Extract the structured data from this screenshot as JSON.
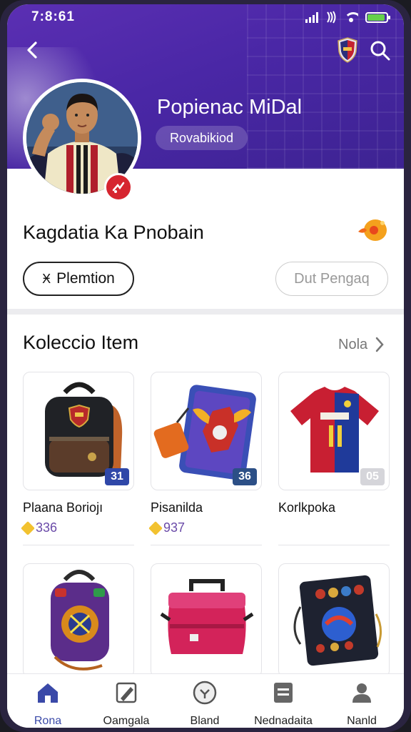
{
  "status_bar": {
    "time": "7:8:61"
  },
  "header": {
    "profile_name": "Popienac MiDal",
    "profile_badge": "Rovabikiod"
  },
  "user": {
    "title": "Kagdatia Ka Pnobain",
    "premium_chip": "Plemtion",
    "premium_icon_glyph": "Ӿ",
    "secondary_button": "Dut Pengaq"
  },
  "collection": {
    "title": "Koleccio Item",
    "more_label": "Nola",
    "items": [
      {
        "name": "Plaana Boriojı",
        "price": "336",
        "qty": "31",
        "qty_color": "#2f47a8",
        "icon": "backpack-icon"
      },
      {
        "name": "Pisanilda",
        "price": "937",
        "qty": "36",
        "qty_color": "#2c4f86",
        "icon": "card-holder-icon"
      },
      {
        "name": "Korlkpoka",
        "price": "",
        "qty": "05",
        "qty_color": "#d5d5da",
        "icon": "jersey-icon"
      },
      {
        "name": "",
        "price": "",
        "qty": "",
        "qty_color": "",
        "icon": "kids-backpack-icon"
      },
      {
        "name": "",
        "price": "",
        "qty": "",
        "qty_color": "",
        "icon": "cooler-bag-icon"
      },
      {
        "name": "",
        "price": "",
        "qty": "",
        "qty_color": "",
        "icon": "memorabilia-case-icon"
      }
    ]
  },
  "bottom_nav": [
    {
      "label": "Rona",
      "icon": "home-icon",
      "active": true
    },
    {
      "label": "Oamgala",
      "icon": "edit-icon",
      "active": false
    },
    {
      "label": "Bland",
      "icon": "ball-icon",
      "active": false
    },
    {
      "label": "Nednadaita",
      "icon": "document-icon",
      "active": false
    },
    {
      "label": "Nanld",
      "icon": "profile-icon",
      "active": false
    }
  ],
  "colors": {
    "header_purple": "#4a27a6",
    "accent_blue": "#3a49a8",
    "price_purple": "#6a4aa8",
    "badge_red": "#d6252f"
  }
}
